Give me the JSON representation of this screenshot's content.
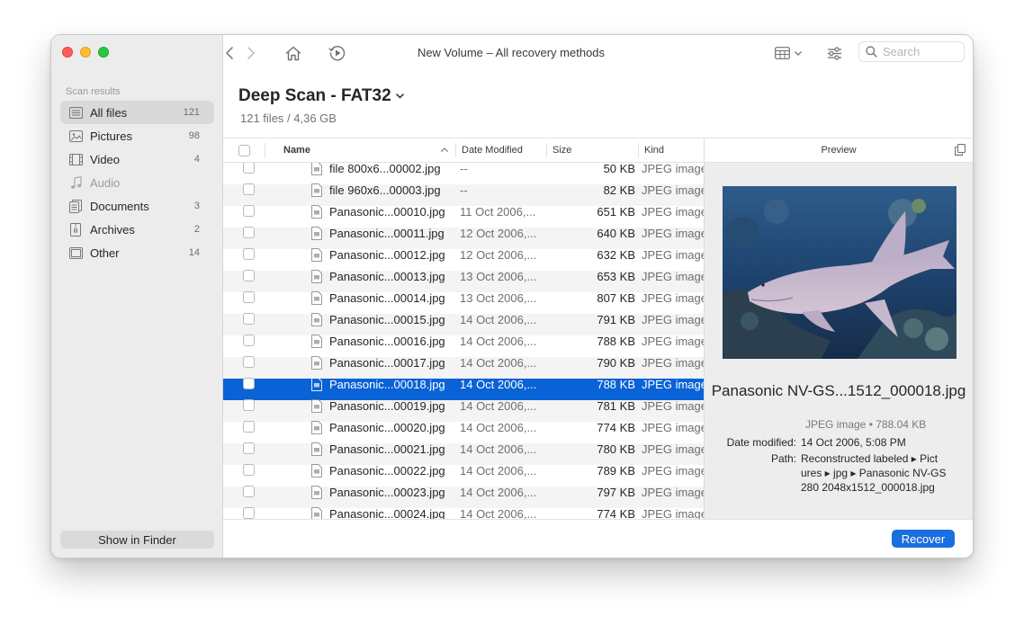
{
  "window": {
    "title": "New Volume – All recovery methods"
  },
  "search": {
    "placeholder": "Search"
  },
  "sidebar": {
    "section": "Scan results",
    "items": [
      {
        "label": "All files",
        "count": "121",
        "icon": "all-files-icon"
      },
      {
        "label": "Pictures",
        "count": "98",
        "icon": "pictures-icon"
      },
      {
        "label": "Video",
        "count": "4",
        "icon": "video-icon"
      },
      {
        "label": "Audio",
        "count": "",
        "icon": "audio-icon"
      },
      {
        "label": "Documents",
        "count": "3",
        "icon": "documents-icon"
      },
      {
        "label": "Archives",
        "count": "2",
        "icon": "archives-icon"
      },
      {
        "label": "Other",
        "count": "14",
        "icon": "other-icon"
      }
    ],
    "finder_button": "Show in Finder"
  },
  "scan": {
    "title": "Deep Scan - FAT32",
    "subtitle": "121 files / 4,36 GB"
  },
  "table": {
    "columns": {
      "name": "Name",
      "date": "Date Modified",
      "size": "Size",
      "kind": "Kind"
    },
    "rows": [
      {
        "name": "file 800x6...00002.jpg",
        "date": "--",
        "size": "50 KB",
        "kind": "JPEG image"
      },
      {
        "name": "file 960x6...00003.jpg",
        "date": "--",
        "size": "82 KB",
        "kind": "JPEG image"
      },
      {
        "name": "Panasonic...00010.jpg",
        "date": "11 Oct 2006,...",
        "size": "651 KB",
        "kind": "JPEG image"
      },
      {
        "name": "Panasonic...00011.jpg",
        "date": "12 Oct 2006,...",
        "size": "640 KB",
        "kind": "JPEG image"
      },
      {
        "name": "Panasonic...00012.jpg",
        "date": "12 Oct 2006,...",
        "size": "632 KB",
        "kind": "JPEG image"
      },
      {
        "name": "Panasonic...00013.jpg",
        "date": "13 Oct 2006,...",
        "size": "653 KB",
        "kind": "JPEG image"
      },
      {
        "name": "Panasonic...00014.jpg",
        "date": "13 Oct 2006,...",
        "size": "807 KB",
        "kind": "JPEG image"
      },
      {
        "name": "Panasonic...00015.jpg",
        "date": "14 Oct 2006,...",
        "size": "791 KB",
        "kind": "JPEG image"
      },
      {
        "name": "Panasonic...00016.jpg",
        "date": "14 Oct 2006,...",
        "size": "788 KB",
        "kind": "JPEG image"
      },
      {
        "name": "Panasonic...00017.jpg",
        "date": "14 Oct 2006,...",
        "size": "790 KB",
        "kind": "JPEG image"
      },
      {
        "name": "Panasonic...00018.jpg",
        "date": "14 Oct 2006,...",
        "size": "788 KB",
        "kind": "JPEG image"
      },
      {
        "name": "Panasonic...00019.jpg",
        "date": "14 Oct 2006,...",
        "size": "781 KB",
        "kind": "JPEG image"
      },
      {
        "name": "Panasonic...00020.jpg",
        "date": "14 Oct 2006,...",
        "size": "774 KB",
        "kind": "JPEG image"
      },
      {
        "name": "Panasonic...00021.jpg",
        "date": "14 Oct 2006,...",
        "size": "780 KB",
        "kind": "JPEG image"
      },
      {
        "name": "Panasonic...00022.jpg",
        "date": "14 Oct 2006,...",
        "size": "789 KB",
        "kind": "JPEG image"
      },
      {
        "name": "Panasonic...00023.jpg",
        "date": "14 Oct 2006,...",
        "size": "797 KB",
        "kind": "JPEG image"
      },
      {
        "name": "Panasonic...00024.jpg",
        "date": "14 Oct 2006,...",
        "size": "774 KB",
        "kind": "JPEG image"
      }
    ]
  },
  "preview": {
    "header": "Preview",
    "filename": "Panasonic NV-GS...1512_000018.jpg",
    "kind": "JPEG image • 788.04 KB",
    "date_label": "Date modified:",
    "date_value": "14 Oct 2006, 5:08 PM",
    "path_label": "Path:",
    "path_line1": "Reconstructed labeled ▸ Pict",
    "path_line2": "ures ▸ jpg ▸ Panasonic NV-GS",
    "path_line3": "280 2048x1512_000018.jpg"
  },
  "footer": {
    "recover_label": "Recover"
  },
  "colors": {
    "accent": "#0962d6",
    "button": "#1a6fe0"
  }
}
